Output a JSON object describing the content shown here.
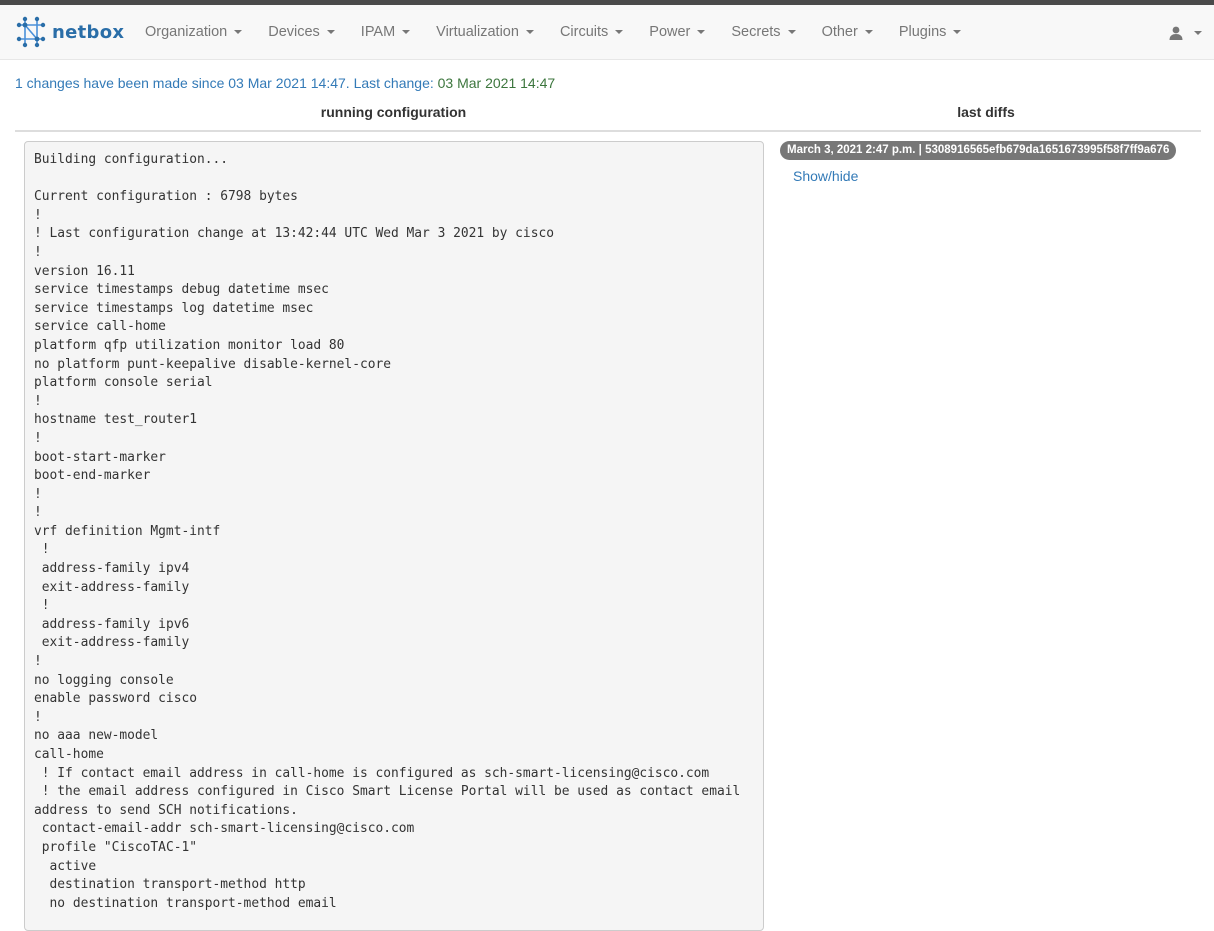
{
  "brand": {
    "name": "netbox",
    "logo_icon": "netbox-logo-icon",
    "accent": "#2a6ea8"
  },
  "nav": {
    "items": [
      {
        "label": "Organization"
      },
      {
        "label": "Devices"
      },
      {
        "label": "IPAM"
      },
      {
        "label": "Virtualization"
      },
      {
        "label": "Circuits"
      },
      {
        "label": "Power"
      },
      {
        "label": "Secrets"
      },
      {
        "label": "Other"
      },
      {
        "label": "Plugins"
      }
    ],
    "user_icon": "user-icon"
  },
  "changes": {
    "prefix": "1 changes have been made since 03 Mar 2021 14:47. Last change: ",
    "last_change": "03 Mar 2021 14:47"
  },
  "columns": {
    "left_title": "running configuration",
    "right_title": "last diffs"
  },
  "config": {
    "text": "Building configuration...\n\nCurrent configuration : 6798 bytes\n!\n! Last configuration change at 13:42:44 UTC Wed Mar 3 2021 by cisco\n!\nversion 16.11\nservice timestamps debug datetime msec\nservice timestamps log datetime msec\nservice call-home\nplatform qfp utilization monitor load 80\nno platform punt-keepalive disable-kernel-core\nplatform console serial\n!\nhostname test_router1\n!\nboot-start-marker\nboot-end-marker\n!\n!\nvrf definition Mgmt-intf\n !\n address-family ipv4\n exit-address-family\n !\n address-family ipv6\n exit-address-family\n!\nno logging console\nenable password cisco\n!\nno aaa new-model\ncall-home\n ! If contact email address in call-home is configured as sch-smart-licensing@cisco.com\n ! the email address configured in Cisco Smart License Portal will be used as contact email address to send SCH notifications.\n contact-email-addr sch-smart-licensing@cisco.com\n profile \"CiscoTAC-1\"\n  active\n  destination transport-method http\n  no destination transport-method email"
  },
  "diff": {
    "badge": "March 3, 2021 2:47 p.m. | 5308916565efb679da1651673995f58f7ff9a676",
    "toggle_label": "Show/hide"
  }
}
